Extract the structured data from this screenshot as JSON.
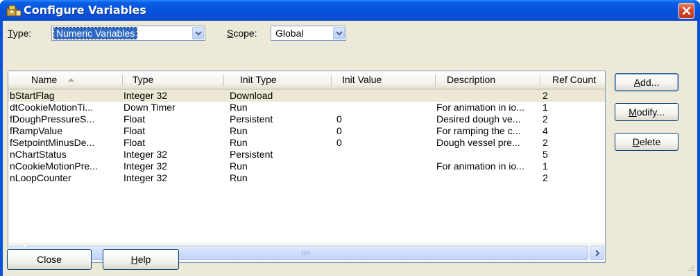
{
  "window": {
    "title": "Configure Variables"
  },
  "filters": {
    "type_label_underlined": "T",
    "type_label_rest": "ype:",
    "type_value": "Numeric Variables",
    "scope_label_underlined": "S",
    "scope_label_rest": "cope:",
    "scope_value": "Global"
  },
  "table": {
    "columns": [
      "Name",
      "Type",
      "Init Type",
      "Init Value",
      "Description",
      "Ref Count"
    ],
    "sorted_column": "Name",
    "rows": [
      {
        "name": "bStartFlag",
        "type": "Integer 32",
        "init_type": "Download",
        "init_value": "",
        "description": "",
        "ref_count": "2"
      },
      {
        "name": "dtCookieMotionTi...",
        "type": "Down Timer",
        "init_type": "Run",
        "init_value": "",
        "description": "For animation in io...",
        "ref_count": "1"
      },
      {
        "name": "fDoughPressureS...",
        "type": "Float",
        "init_type": "Persistent",
        "init_value": "0",
        "description": "Desired dough ve...",
        "ref_count": "2"
      },
      {
        "name": "fRampValue",
        "type": "Float",
        "init_type": "Run",
        "init_value": "0",
        "description": "For ramping the c...",
        "ref_count": "4"
      },
      {
        "name": "fSetpointMinusDe...",
        "type": "Float",
        "init_type": "Run",
        "init_value": "0",
        "description": "Dough vessel pre...",
        "ref_count": "2"
      },
      {
        "name": "nChartStatus",
        "type": "Integer 32",
        "init_type": "Persistent",
        "init_value": "",
        "description": "",
        "ref_count": "5"
      },
      {
        "name": "nCookieMotionPre...",
        "type": "Integer 32",
        "init_type": "Run",
        "init_value": "",
        "description": "For animation in io...",
        "ref_count": "1"
      },
      {
        "name": "nLoopCounter",
        "type": "Integer 32",
        "init_type": "Run",
        "init_value": "",
        "description": "",
        "ref_count": "2"
      }
    ]
  },
  "buttons": {
    "add_underlined": "A",
    "add_rest": "dd...",
    "modify_underlined": "M",
    "modify_rest": "odify...",
    "delete_underlined": "D",
    "delete_rest": "elete",
    "close": "Close",
    "help_underlined": "H",
    "help_rest": "elp"
  },
  "colors": {
    "titlebar": "#0552da",
    "dialog_bg": "#ece9d8",
    "selection": "#316ac5",
    "close_button": "#d9482a"
  }
}
